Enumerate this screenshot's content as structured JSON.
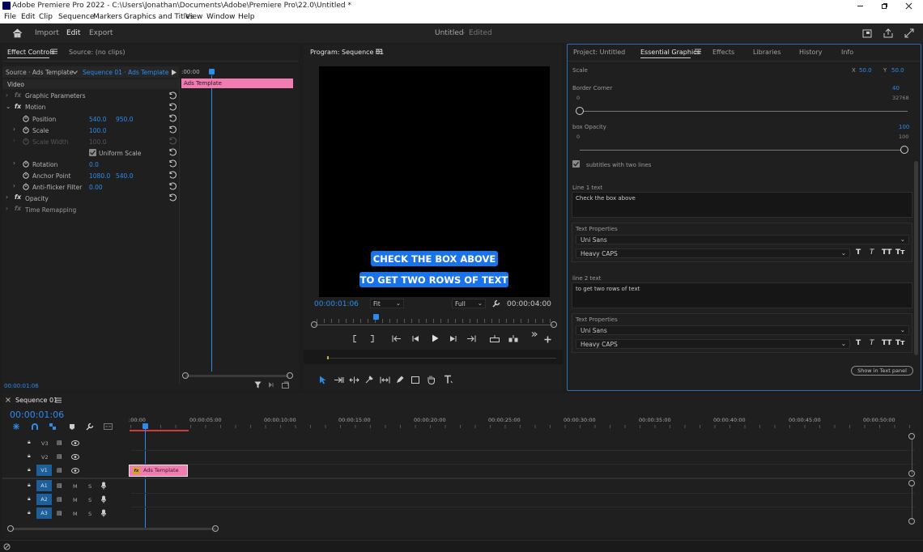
{
  "titlebar": {
    "title": "Adobe Premiere Pro 2022 - C:\\Users\\Jonathan\\Documents\\Adobe\\Premiere Pro\\22.0\\Untitled *"
  },
  "menu": [
    "File",
    "Edit",
    "Clip",
    "Sequence",
    "Markers",
    "Graphics and Titles",
    "View",
    "Window",
    "Help"
  ],
  "header": {
    "tabs": [
      "Import",
      "Edit",
      "Export"
    ],
    "active": "Edit",
    "project_title": "Untitled",
    "project_status": "Edited"
  },
  "effect_controls": {
    "tab_label": "Effect Controls",
    "source_tab": "Source: (no clips)",
    "source_master": "Source · Ads Template",
    "sequence_clip": "Sequence 01 · Ads Template",
    "time_start": ":00:00",
    "clip_label": "Ads Template",
    "section": "Video",
    "rows": [
      {
        "label": "Graphic Parameters"
      },
      {
        "label": "Motion"
      },
      {
        "label": "Position",
        "v1": "540.0",
        "v2": "950.0"
      },
      {
        "label": "Scale",
        "v1": "100.0"
      },
      {
        "label": "Scale Width",
        "v1": "100.0"
      },
      {
        "label": "Uniform Scale"
      },
      {
        "label": "Rotation",
        "v1": "0.0"
      },
      {
        "label": "Anchor Point",
        "v1": "1080.0",
        "v2": "540.0"
      },
      {
        "label": "Anti-flicker Filter",
        "v1": "0.00"
      },
      {
        "label": "Opacity"
      },
      {
        "label": "Time Remapping"
      }
    ],
    "timecode": "00:00:01:06"
  },
  "program": {
    "title": "Program: Sequence 01",
    "caption_line1": "CHECK THE BOX ABOVE",
    "caption_line2": "TO GET TWO ROWS OF TEXT",
    "timecode": "00:00:01:06",
    "fit": "Fit",
    "quality": "Full",
    "duration": "00:00:04:00"
  },
  "essential_graphics": {
    "tabs": [
      "Project: Untitled",
      "Essential Graphics",
      "Effects",
      "Libraries",
      "History",
      "Info"
    ],
    "active": "Essential Graphics",
    "scale_label": "Scale",
    "x_label": "X",
    "x_value": "50.0",
    "y_label": "Y",
    "y_value": "50.0",
    "border_corner_label": "Border Corner",
    "border_corner_value": "40",
    "border_corner_min": "0",
    "border_corner_max": "32768",
    "box_opacity_label": "box Opacity",
    "box_opacity_value": "100",
    "box_opacity_min": "0",
    "box_opacity_max": "100",
    "checkbox_label": "subtitles with two lines",
    "line1_label": "Line 1 text",
    "line1_text": "Check the box above",
    "text_props_label": "Text Properties",
    "font1": "Uni Sans",
    "style1": "Heavy CAPS",
    "line2_label": "line 2 text",
    "line2_text": "to get two rows of text",
    "font2": "Uni Sans",
    "style2": "Heavy CAPS",
    "show_text_panel": "Show in Text panel"
  },
  "timeline": {
    "tab_label": "Sequence 01",
    "timecode": "00:00:01:06",
    "ruler": [
      ":00:00",
      "00:00:05:00",
      "00:00:10:00",
      "00:00:15:00",
      "00:00:20:00",
      "00:00:25:00",
      "00:00:30:00",
      "00:00:35:00",
      "00:00:40:00",
      "00:00:45:00",
      "00:00:50:00"
    ],
    "tracks": [
      {
        "name": "V3"
      },
      {
        "name": "V2"
      },
      {
        "name": "V1"
      },
      {
        "name": "A1",
        "m": "M",
        "s": "S"
      },
      {
        "name": "A2",
        "m": "M",
        "s": "S"
      },
      {
        "name": "A3",
        "m": "M",
        "s": "S"
      }
    ],
    "clip_label": "Ads Template"
  },
  "colors": {
    "accent": "#2d8ceb",
    "clip_pink": "#f07cb0",
    "caption_blue": "#1a73e8"
  }
}
